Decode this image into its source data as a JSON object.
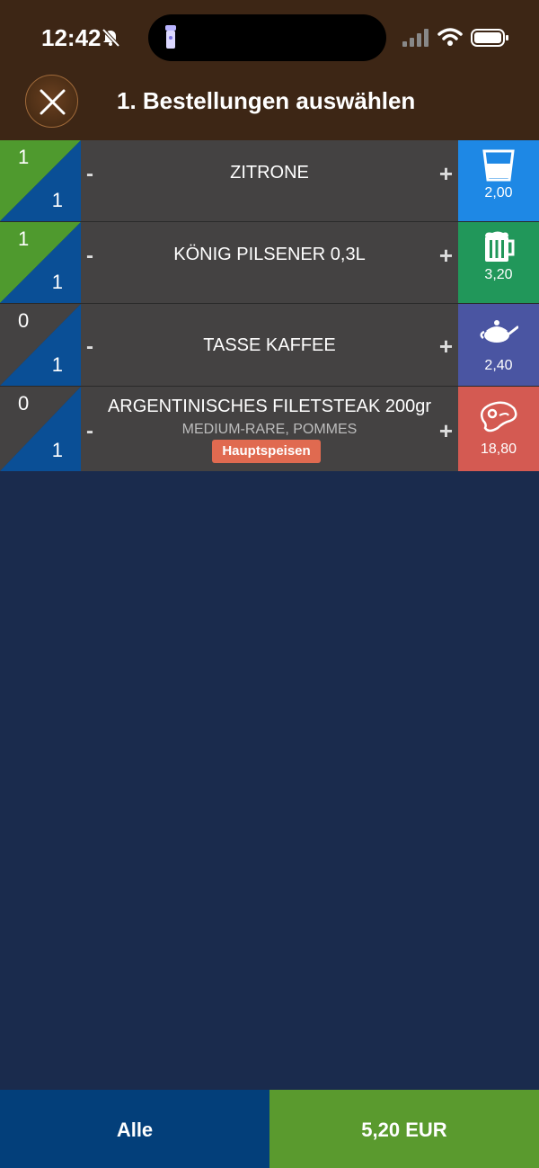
{
  "status": {
    "time": "12:42"
  },
  "header": {
    "title": "1. Bestellungen auswählen"
  },
  "orders": [
    {
      "qty_selected": "1",
      "qty_total": "1",
      "name": "ZITRONE",
      "price": "2,00",
      "icon": "glass-icon",
      "color": "#1e88e5",
      "qty_color": "#4f9a2e"
    },
    {
      "qty_selected": "1",
      "qty_total": "1",
      "name": "KÖNIG PILSENER 0,3L",
      "price": "3,20",
      "icon": "beer-mug-icon",
      "color": "#21975a",
      "qty_color": "#4f9a2e"
    },
    {
      "qty_selected": "0",
      "qty_total": "1",
      "name": "TASSE KAFFEE",
      "price": "2,40",
      "icon": "teapot-icon",
      "color": "#4a55a2",
      "qty_color": "#444242"
    },
    {
      "qty_selected": "0",
      "qty_total": "1",
      "name": "ARGENTINISCHES FILETSTEAK 200gr",
      "sub": "MEDIUM-RARE, POMMES",
      "tag": "Hauptspeisen",
      "price": "18,80",
      "icon": "steak-icon",
      "color": "#d45a52",
      "qty_color": "#444242"
    }
  ],
  "controls": {
    "minus": "-",
    "plus": "+"
  },
  "footer": {
    "all_label": "Alle",
    "total_label": "5,20 EUR"
  },
  "colors": {
    "header_bg": "#3d2615",
    "body_bg": "#1a2b4d",
    "qty_blue": "#0a4f96"
  }
}
